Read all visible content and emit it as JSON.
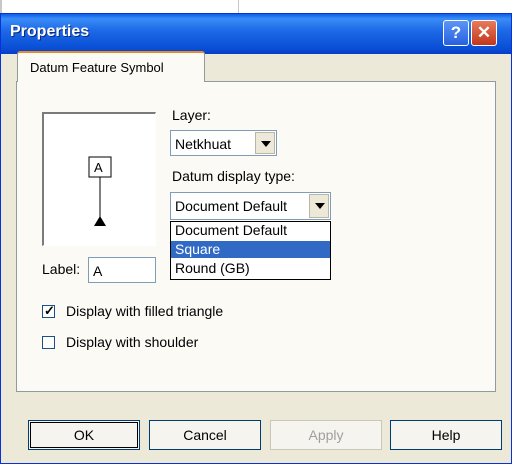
{
  "window": {
    "title": "Properties",
    "help_icon": "question-mark-icon",
    "close_icon": "close-x-icon"
  },
  "tab": {
    "label": "Datum Feature Symbol"
  },
  "preview": {
    "symbol_letter": "A"
  },
  "layer": {
    "label": "Layer:",
    "value": "Netkhuat"
  },
  "datum_display": {
    "label": "Datum display type:",
    "value": "Document Default",
    "options": [
      "Document Default",
      "Square",
      "Round (GB)"
    ],
    "highlighted": "Square"
  },
  "label_field": {
    "label": "Label:",
    "value": "A"
  },
  "checkboxes": {
    "filled_triangle": {
      "label": "Display with filled triangle",
      "checked": true
    },
    "shoulder": {
      "label": "Display with shoulder",
      "checked": false
    }
  },
  "buttons": {
    "ok": "OK",
    "cancel": "Cancel",
    "apply": "Apply",
    "help": "Help"
  },
  "colors": {
    "title_bar": "#0a5fe8",
    "dialog_bg": "#ece9d8",
    "selection": "#316ac5"
  }
}
